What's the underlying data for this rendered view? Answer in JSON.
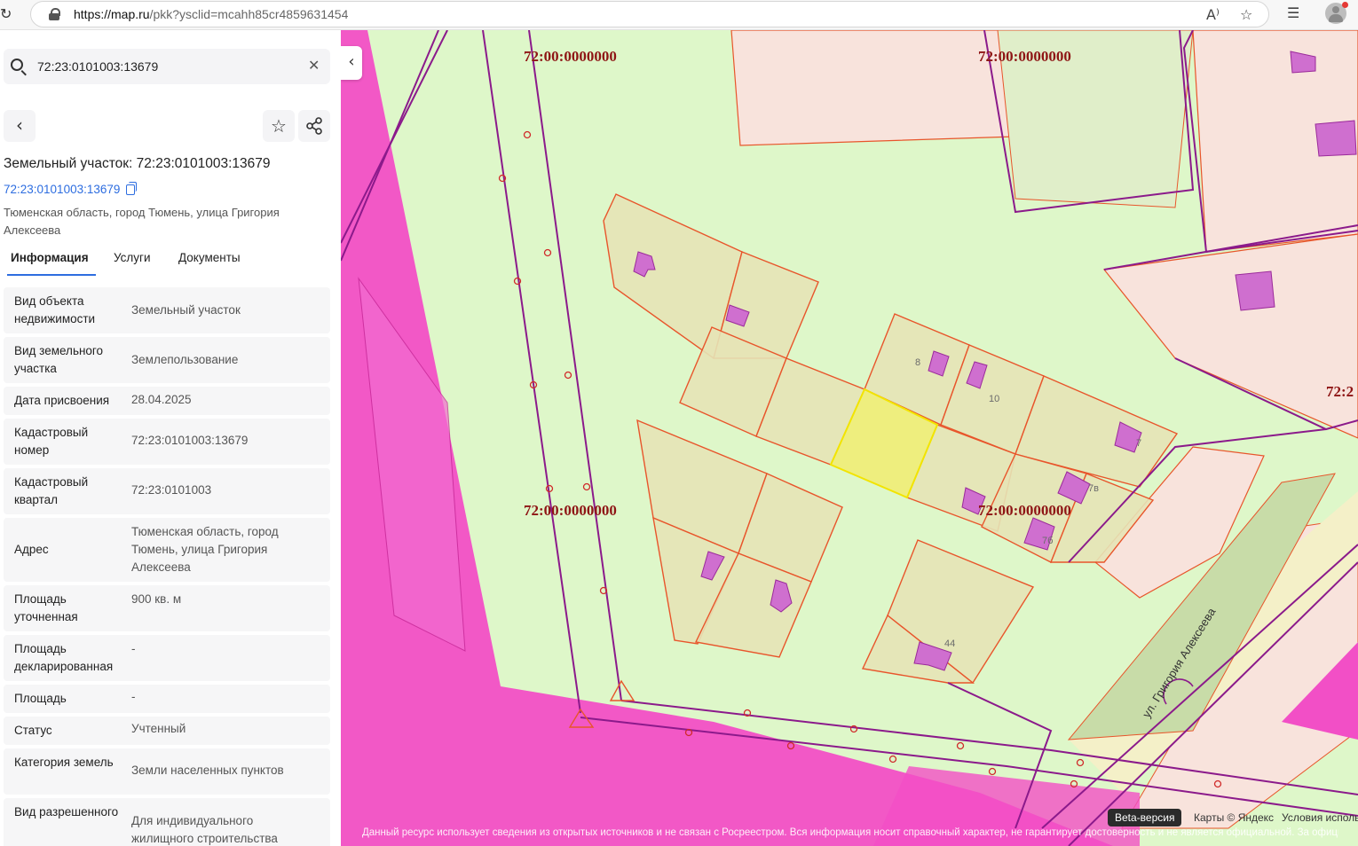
{
  "browser": {
    "url_host": "https://map.ru",
    "url_rest": "/pkk?ysclid=mcahh85cr4859631454",
    "reload_icon": "reload-icon",
    "read_aloud_label": "A⁾",
    "icons": [
      "lock-icon",
      "read-aloud-icon",
      "favorite-star-icon",
      "favorites-list-icon",
      "profile-avatar-icon"
    ]
  },
  "sidebar": {
    "search": {
      "value": "72:23:0101003:13679",
      "placeholder": ""
    },
    "title": "Земельный участок: 72:23:0101003:13679",
    "cad_link": "72:23:0101003:13679",
    "address_sub": "Тюменская область, город Тюмень, улица Григория Алексеева",
    "tabs": [
      {
        "label": "Информация",
        "active": true
      },
      {
        "label": "Услуги",
        "active": false
      },
      {
        "label": "Документы",
        "active": false
      }
    ],
    "rows": [
      {
        "key": "Вид объекта недвижимости",
        "value": "Земельный участок"
      },
      {
        "key": "Вид земельного участка",
        "value": "Землепользование"
      },
      {
        "key": "Дата присвоения",
        "value": "28.04.2025"
      },
      {
        "key": "Кадастровый номер",
        "value": "72:23:0101003:13679"
      },
      {
        "key": "Кадастровый квартал",
        "value": "72:23:0101003"
      },
      {
        "key": "Адрес",
        "value": "Тюменская область, город Тюмень, улица Григория Алексеева"
      },
      {
        "key": "Площадь уточненная",
        "value": "900 кв. м"
      },
      {
        "key": "Площадь декларированная",
        "value": "-"
      },
      {
        "key": "Площадь",
        "value": "-"
      },
      {
        "key": "Статус",
        "value": "Учтенный"
      },
      {
        "key": "Категория земель",
        "value": "Земли населенных пунктов"
      },
      {
        "key": "Вид разрешенного",
        "value": "Для индивидуального жилищного строительства"
      }
    ]
  },
  "map": {
    "quarter_labels": [
      "72:00:0000000",
      "72:00:0000000",
      "72:00:0000000",
      "72:00:0000000",
      "72:2"
    ],
    "plot_numbers": [
      "8",
      "10",
      "7",
      "7в",
      "7б",
      "44"
    ],
    "street": "ул. Григория Алексеева",
    "beta": "Beta-версия",
    "copyright": "Карты © Яндекс",
    "terms": "Условия исполь",
    "disclaimer": "Данный ресурс использует сведения из открытых источников и не связан с Росреестром. Вся информация носит справочный характер, не гарантирует достоверность и не является официальной. За официальными сведениями обращайтесь в Росреестр.",
    "colors": {
      "background": "#def7c9",
      "restricted_zone": "#f24fc6",
      "plot_fill": "#e6e3b6",
      "plot_border": "#e8552b",
      "selected_plot": "#eeee7e",
      "building": "#cf6fcf",
      "quarter_line": "#8b1a8b",
      "quarter_label": "#8e1515",
      "urban_fill": "#f8e3dc"
    }
  }
}
